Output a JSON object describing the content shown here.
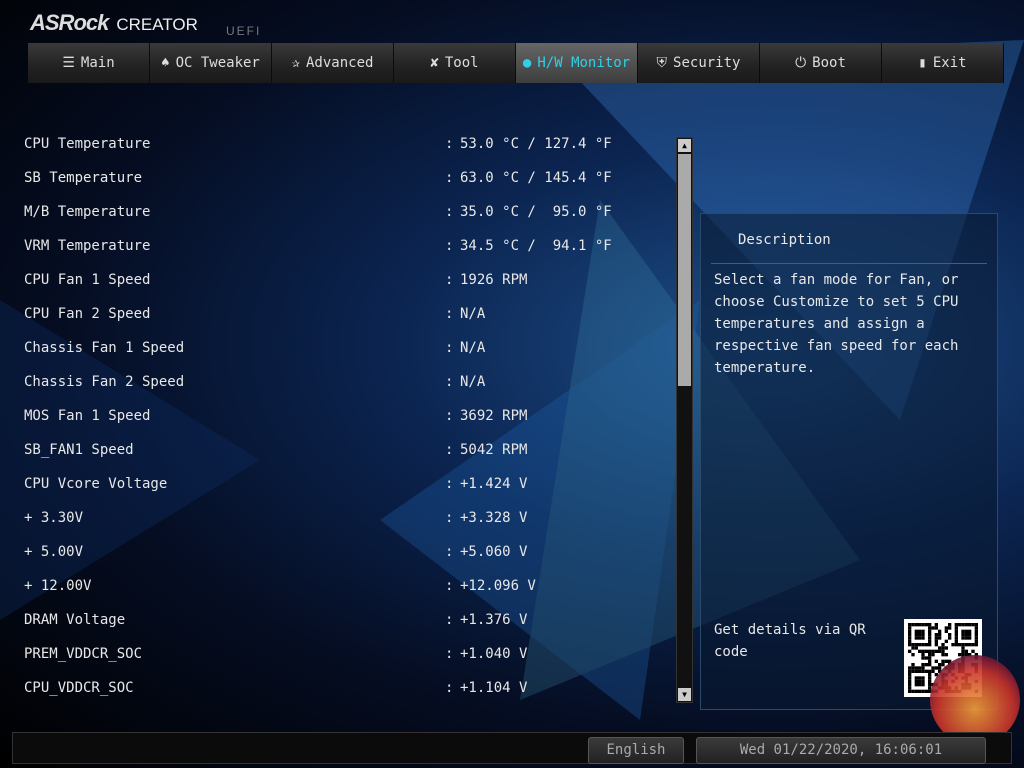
{
  "header": {
    "brand": "ASRock",
    "product": "CREATOR",
    "sub": "UEFI"
  },
  "tabs": [
    {
      "label": "Main",
      "icon": "list-icon",
      "glyph": "☰"
    },
    {
      "label": "OC Tweaker",
      "icon": "rocket-icon",
      "glyph": "♠"
    },
    {
      "label": "Advanced",
      "icon": "star-icon",
      "glyph": "✰"
    },
    {
      "label": "Tool",
      "icon": "tools-icon",
      "glyph": "✘"
    },
    {
      "label": "H/W Monitor",
      "icon": "monitor-icon",
      "glyph": "●"
    },
    {
      "label": "Security",
      "icon": "shield-icon",
      "glyph": "⛨"
    },
    {
      "label": "Boot",
      "icon": "power-icon",
      "glyph": "⏻"
    },
    {
      "label": "Exit",
      "icon": "door-icon",
      "glyph": "▮"
    }
  ],
  "rows": [
    {
      "label": "CPU Temperature",
      "value": "53.0 °C / 127.4 °F"
    },
    {
      "label": "SB Temperature",
      "value": "63.0 °C / 145.4 °F"
    },
    {
      "label": "M/B Temperature",
      "value": "35.0 °C /  95.0 °F"
    },
    {
      "label": "VRM Temperature",
      "value": "34.5 °C /  94.1 °F"
    },
    {
      "label": "CPU Fan 1 Speed",
      "value": "1926 RPM"
    },
    {
      "label": "CPU Fan 2 Speed",
      "value": "N/A"
    },
    {
      "label": "Chassis Fan 1 Speed",
      "value": "N/A"
    },
    {
      "label": "Chassis Fan 2 Speed",
      "value": "N/A"
    },
    {
      "label": "MOS Fan 1 Speed",
      "value": "3692 RPM"
    },
    {
      "label": "SB_FAN1 Speed",
      "value": "5042 RPM"
    },
    {
      "label": "CPU Vcore Voltage",
      "value": "+1.424 V"
    },
    {
      "label": "+ 3.30V",
      "value": "+3.328 V"
    },
    {
      "label": "+ 5.00V",
      "value": "+5.060 V"
    },
    {
      "label": "+ 12.00V",
      "value": "+12.096 V"
    },
    {
      "label": "DRAM Voltage",
      "value": "+1.376 V"
    },
    {
      "label": "PREM_VDDCR_SOC",
      "value": "+1.040 V"
    },
    {
      "label": "CPU_VDDCR_SOC",
      "value": "+1.104 V"
    }
  ],
  "separator": ":",
  "description": {
    "title": "Description",
    "text": "Select a fan mode for Fan, or choose Customize to set 5 CPU temperatures and assign a respective fan speed for each temperature.",
    "qr_text": "Get details via QR code"
  },
  "footer": {
    "language": "English",
    "datetime": "Wed 01/22/2020, 16:06:01"
  }
}
